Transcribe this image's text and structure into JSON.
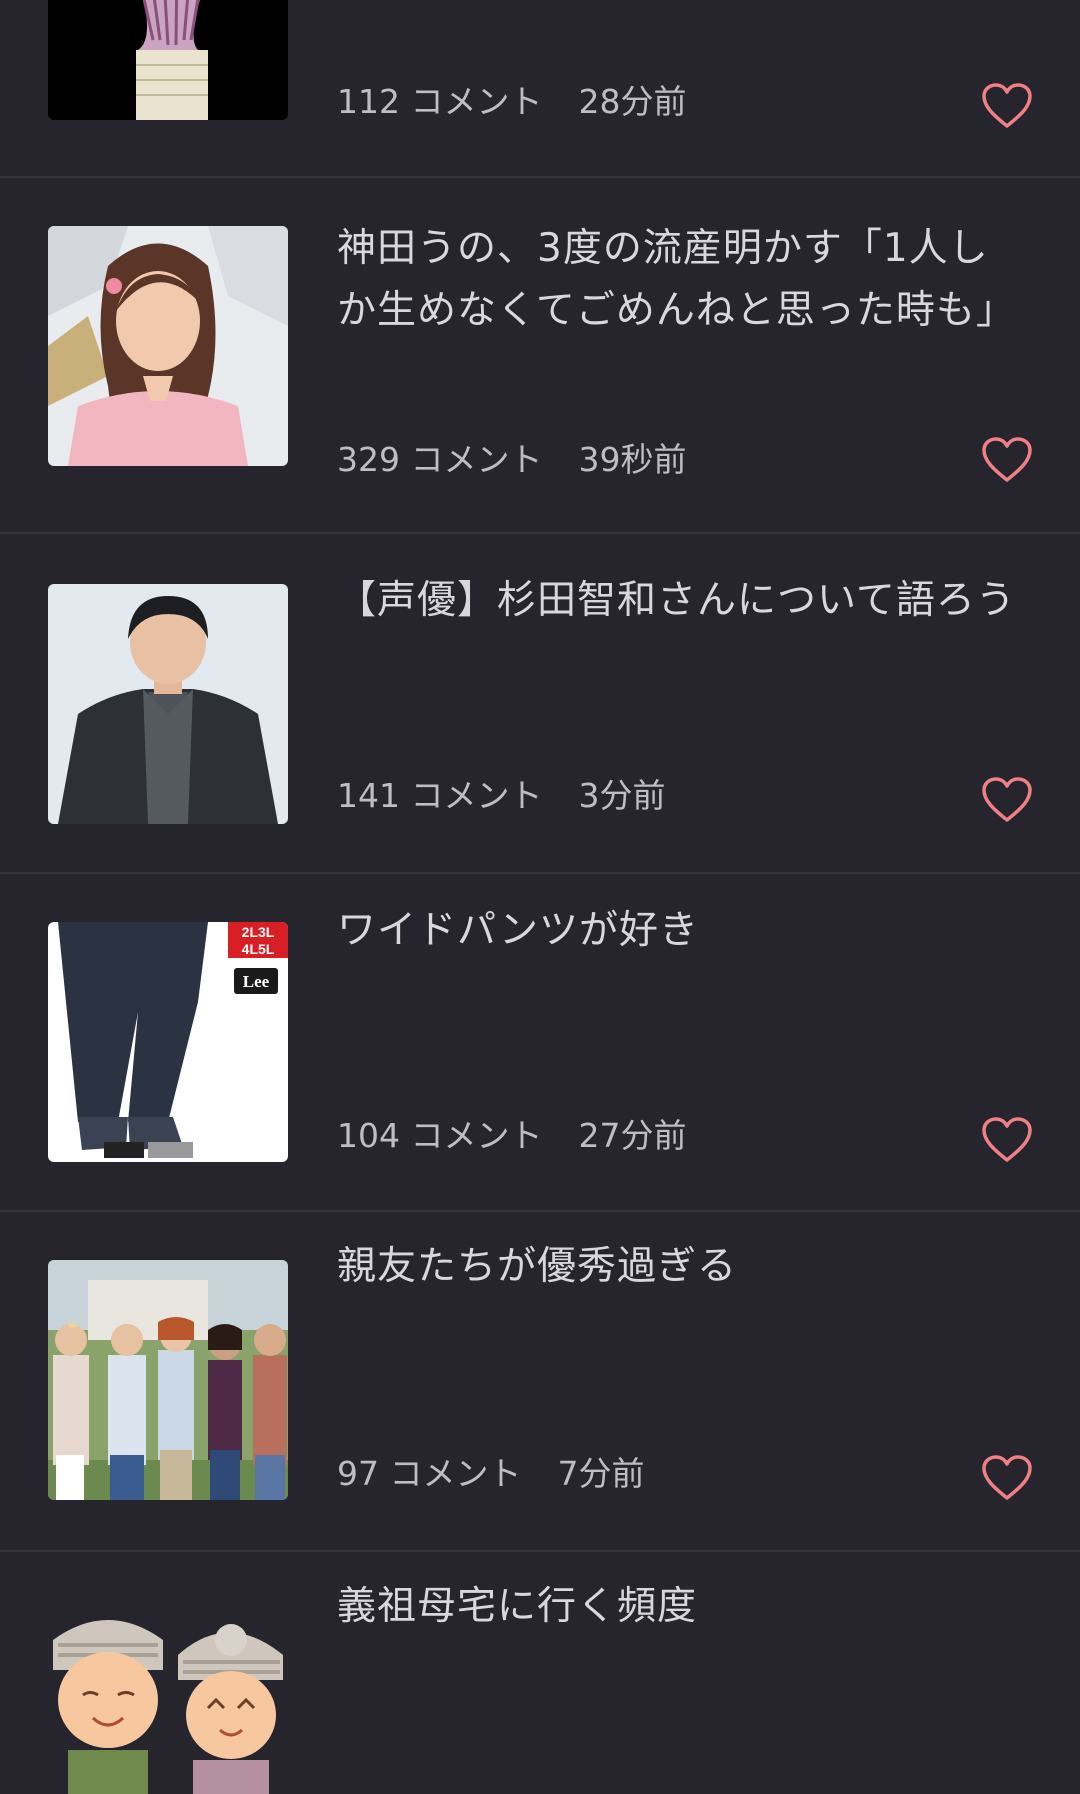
{
  "colors": {
    "background": "#26252d",
    "divider": "#35343c",
    "title_text": "#d7d7dc",
    "meta_text": "#bdbdc3",
    "heart": "#f07f86"
  },
  "items": [
    {
      "title": "",
      "comments": "112 コメント",
      "time": "28分前",
      "thumbnail_icon": "flower-photo",
      "favorite_icon": "heart-outline-icon"
    },
    {
      "title": "神田うの、3度の流産明かす「1人しか生めなくてごめんねと思った時も」",
      "comments": "329 コメント",
      "time": "39秒前",
      "thumbnail_icon": "woman-portrait-photo",
      "favorite_icon": "heart-outline-icon"
    },
    {
      "title": "【声優】杉田智和さんについて語ろう",
      "comments": "141 コメント",
      "time": "3分前",
      "thumbnail_icon": "man-in-suit-photo",
      "favorite_icon": "heart-outline-icon"
    },
    {
      "title": "ワイドパンツが好き",
      "comments": "104 コメント",
      "time": "27分前",
      "thumbnail_icon": "wide-pants-photo",
      "thumbnail_text": [
        "2L3L",
        "4L5L",
        "Lee"
      ],
      "favorite_icon": "heart-outline-icon"
    },
    {
      "title": "親友たちが優秀過ぎる",
      "comments": "97 コメント",
      "time": "7分前",
      "thumbnail_icon": "group-of-women-photo",
      "favorite_icon": "heart-outline-icon"
    },
    {
      "title": "義祖母宅に行く頻度",
      "comments": "",
      "time": "",
      "thumbnail_icon": "grandparents-illustration",
      "favorite_icon": ""
    }
  ]
}
